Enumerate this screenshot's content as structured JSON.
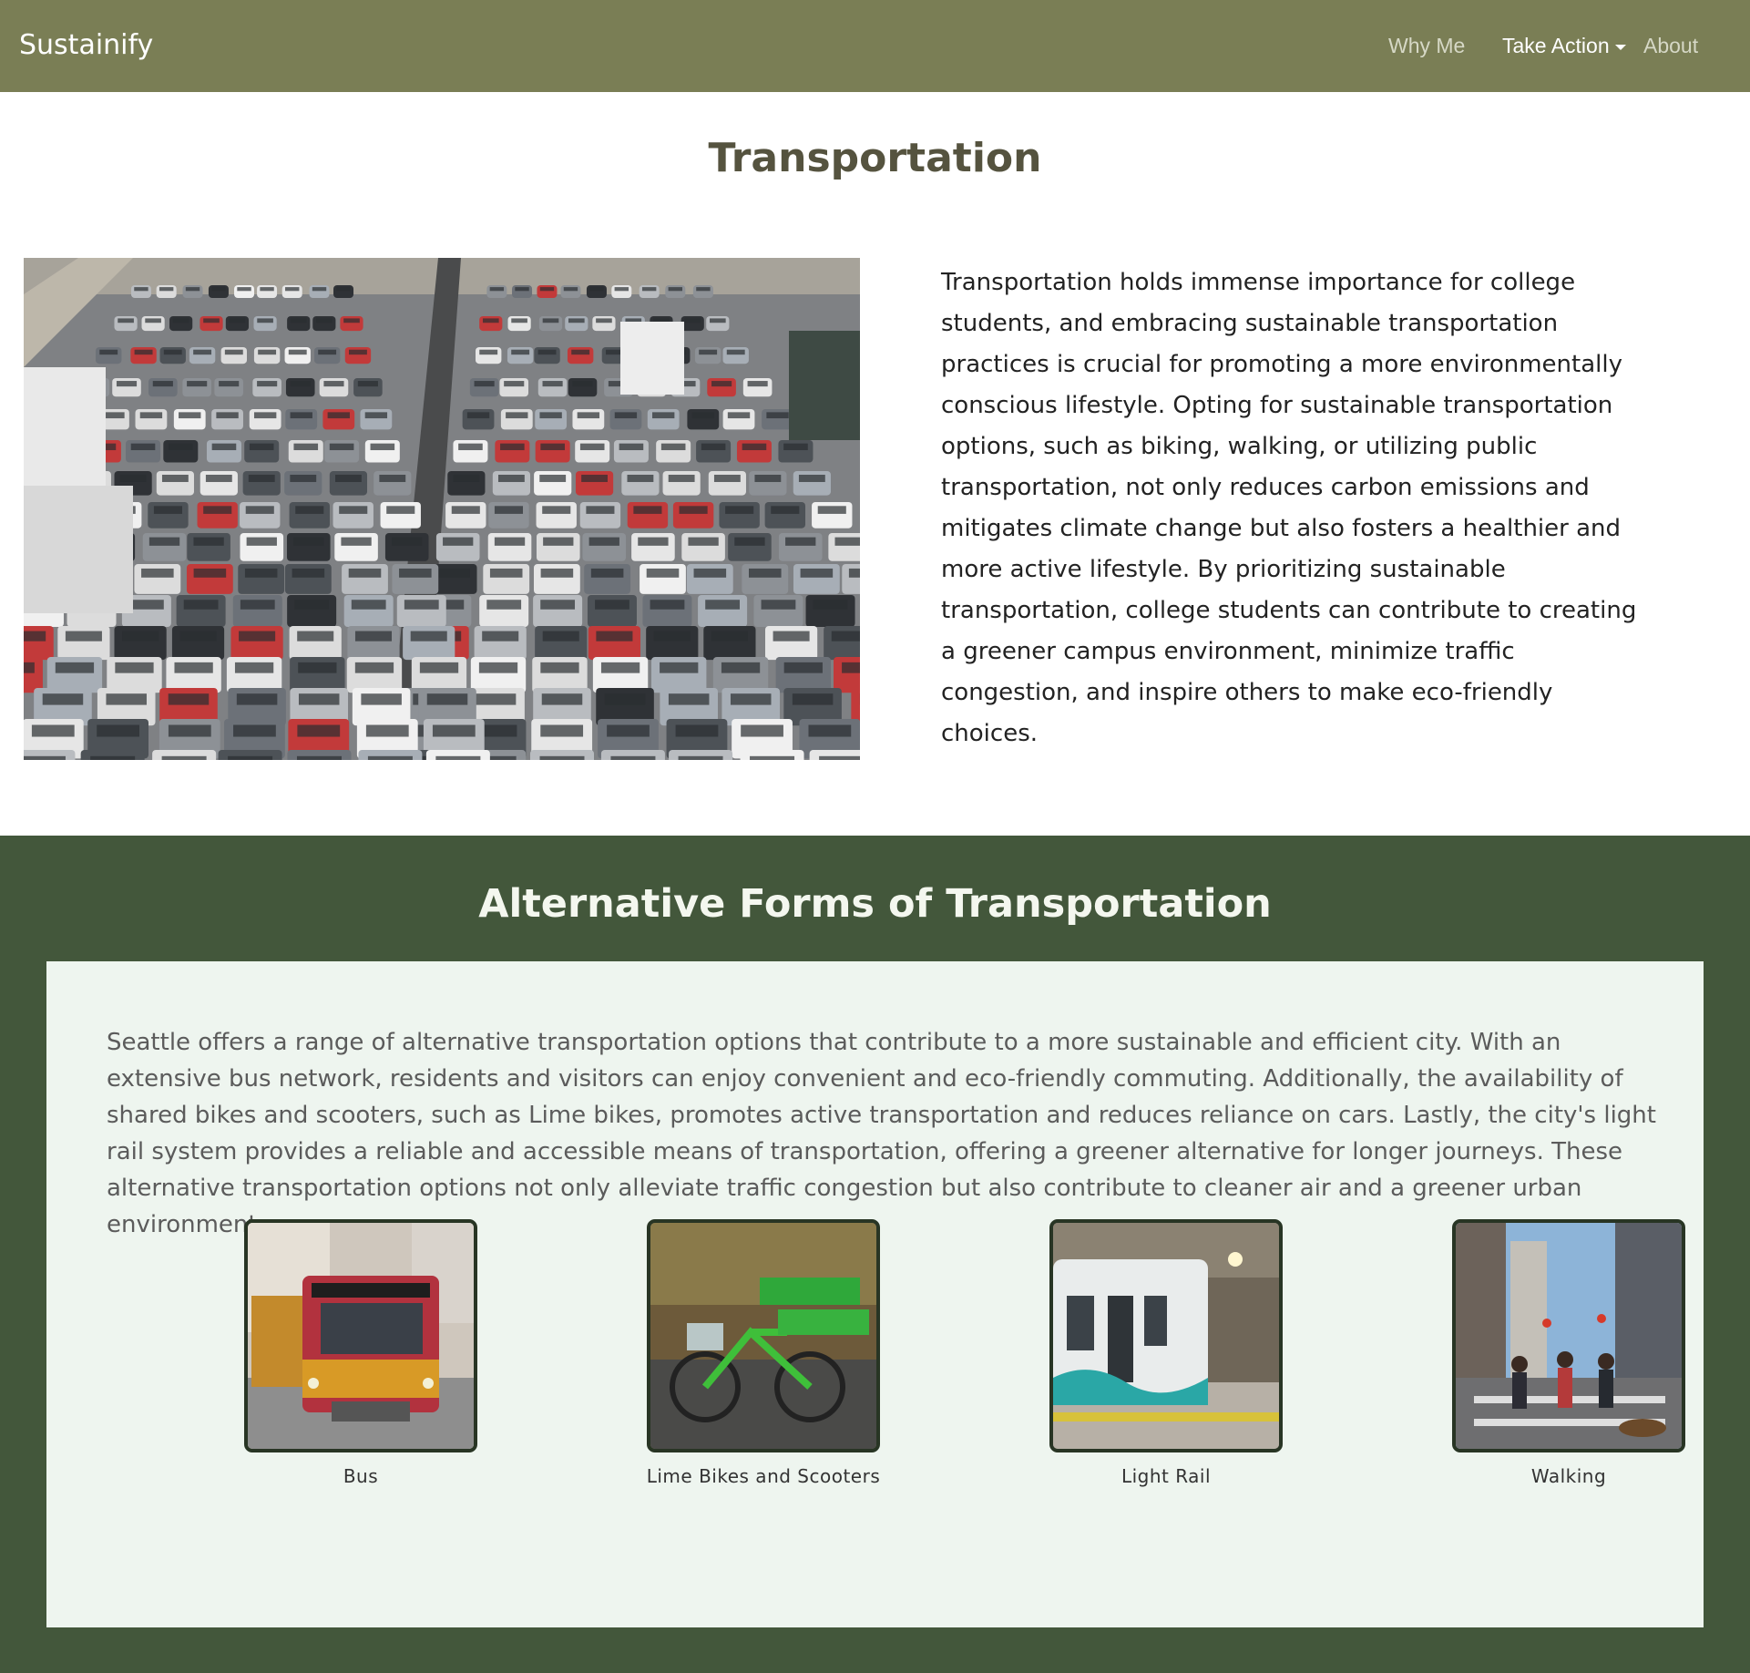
{
  "nav": {
    "brand": "Sustainify",
    "links": [
      "Why Me",
      "Take Action",
      "About"
    ]
  },
  "page": {
    "title": "Transportation",
    "intro": "Transportation holds immense importance for college students, and embracing sustainable transportation practices is crucial for promoting a more environmentally conscious lifestyle. Opting for sustainable transportation options, such as biking, walking, or utilizing public transportation, not only reduces carbon emissions and mitigates climate change but also fosters a healthier and more active lifestyle. By prioritizing sustainable transportation, college students can contribute to creating a greener campus environment, minimize traffic congestion, and inspire others to make eco-friendly choices."
  },
  "alternatives": {
    "title": "Alternative Forms of Transportation",
    "text": "Seattle offers a range of alternative transportation options that contribute to a more sustainable and efficient city. With an extensive bus network, residents and visitors can enjoy convenient and eco-friendly commuting. Additionally, the availability of shared bikes and scooters, such as Lime bikes, promotes active transportation and reduces reliance on cars. Lastly, the city's light rail system provides a reliable and accessible means of transportation, offering a greener alternative for longer journeys. These alternative transportation options not only alleviate traffic congestion but also contribute to cleaner air and a greener urban environment.",
    "cards": [
      {
        "caption": "Bus"
      },
      {
        "caption": "Lime Bikes and Scooters"
      },
      {
        "caption": "Light Rail"
      },
      {
        "caption": "Walking"
      }
    ]
  },
  "colors": {
    "navbar": "#7a7e55",
    "section_bg": "#43573b",
    "panel_bg": "#eef5ef",
    "title": "#55533f"
  }
}
